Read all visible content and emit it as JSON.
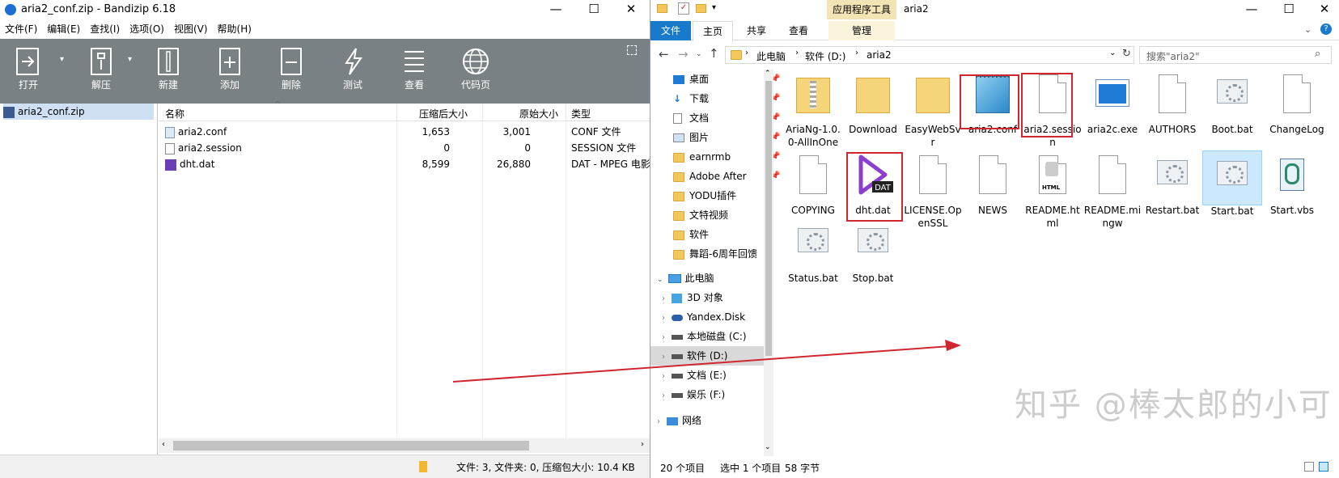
{
  "bandizip": {
    "title": "aria2_conf.zip - Bandizip 6.18",
    "menu": [
      "文件(F)",
      "编辑(E)",
      "查找(I)",
      "选项(O)",
      "视图(V)",
      "帮助(H)"
    ],
    "toolbar": [
      "打开",
      "解压",
      "新建",
      "添加",
      "删除",
      "测试",
      "查看",
      "代码页"
    ],
    "tree_root": "aria2_conf.zip",
    "columns": [
      "名称",
      "压缩后大小",
      "原始大小",
      "类型"
    ],
    "files": [
      {
        "name": "aria2.conf",
        "packed": "1,653",
        "size": "3,001",
        "type": "CONF 文件"
      },
      {
        "name": "aria2.session",
        "packed": "0",
        "size": "0",
        "type": "SESSION 文件"
      },
      {
        "name": "dht.dat",
        "packed": "8,599",
        "size": "26,880",
        "type": "DAT - MPEG 电影"
      }
    ],
    "status": "文件: 3, 文件夹: 0, 压缩包大小: 10.4 KB"
  },
  "explorer": {
    "title": "aria2",
    "context_tab": "应用程序工具",
    "tabs": [
      "文件",
      "主页",
      "共享",
      "查看",
      "管理"
    ],
    "breadcrumb": [
      "此电脑",
      "软件 (D:)",
      "aria2"
    ],
    "search_placeholder": "搜索\"aria2\"",
    "quick_access": [
      "桌面",
      "下载",
      "文档",
      "图片",
      "earnrmb",
      "Adobe After",
      "YODU插件",
      "文特视频",
      "软件",
      "舞蹈-6周年回馈"
    ],
    "this_pc": "此电脑",
    "drives": [
      "3D 对象",
      "Yandex.Disk",
      "本地磁盘 (C:)",
      "软件 (D:)",
      "文档 (E:)",
      "娱乐 (F:)"
    ],
    "network": "网络",
    "files": [
      {
        "name": "AriaNg-1.0.0-AllInOne",
        "icon": "zip-folder"
      },
      {
        "name": "Download",
        "icon": "folder"
      },
      {
        "name": "EasyWebSvr",
        "icon": "folder"
      },
      {
        "name": "aria2.conf",
        "icon": "notepad"
      },
      {
        "name": "aria2.session",
        "icon": "blank"
      },
      {
        "name": "aria2c.exe",
        "icon": "exe"
      },
      {
        "name": "AUTHORS",
        "icon": "blank"
      },
      {
        "name": "Boot.bat",
        "icon": "gear"
      },
      {
        "name": "ChangeLog",
        "icon": "blank"
      },
      {
        "name": "COPYING",
        "icon": "blank"
      },
      {
        "name": "dht.dat",
        "icon": "dat"
      },
      {
        "name": "LICENSE.OpenSSL",
        "icon": "blank"
      },
      {
        "name": "NEWS",
        "icon": "blank"
      },
      {
        "name": "README.html",
        "icon": "html"
      },
      {
        "name": "README.mingw",
        "icon": "blank"
      },
      {
        "name": "Restart.bat",
        "icon": "gear"
      },
      {
        "name": "Start.bat",
        "icon": "gear"
      },
      {
        "name": "Start.vbs",
        "icon": "vbs"
      },
      {
        "name": "Status.bat",
        "icon": "gear"
      },
      {
        "name": "Stop.bat",
        "icon": "gear"
      }
    ],
    "status": {
      "count": "20 个项目",
      "selected": "选中 1 个项目",
      "size": "58 字节"
    }
  },
  "watermark": "知乎 @棒太郎的小可爱"
}
